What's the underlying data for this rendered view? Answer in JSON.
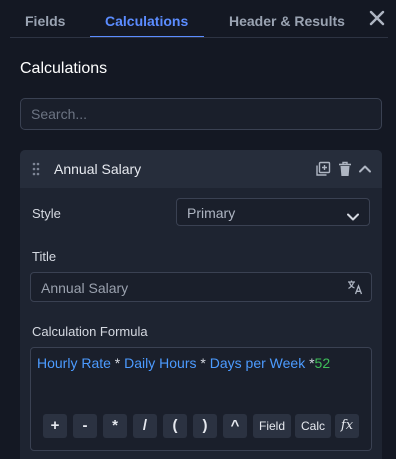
{
  "tabs": [
    {
      "label": "Fields",
      "active": false
    },
    {
      "label": "Calculations",
      "active": true
    },
    {
      "label": "Header & Results",
      "active": false
    }
  ],
  "section_title": "Calculations",
  "search": {
    "placeholder": "Search...",
    "value": ""
  },
  "card": {
    "title": "Annual Salary",
    "style_label": "Style",
    "style_value": "Primary",
    "title_label": "Title",
    "title_value": "Annual Salary",
    "formula_label": "Calculation Formula",
    "formula": {
      "field1": "Hourly Rate",
      "op1": " * ",
      "field2": "Daily Hours",
      "op2": " * ",
      "field3": "Days per Week",
      "op3": " *",
      "number": "52"
    },
    "keypad": {
      "plus": "+",
      "minus": "-",
      "multiply": "*",
      "divide": "/",
      "lparen": "(",
      "rparen": ")",
      "power": "^",
      "field": "Field",
      "calc": "Calc",
      "fx": "fx"
    }
  },
  "icons": [
    "close-icon",
    "drag-handle-icon",
    "duplicate-icon",
    "trash-icon",
    "chevron-up-icon",
    "chevron-down-icon",
    "translate-icon"
  ],
  "colors": {
    "accent": "#5b8cff",
    "field_token": "#4c9bff",
    "number_token": "#3fbf5a"
  }
}
